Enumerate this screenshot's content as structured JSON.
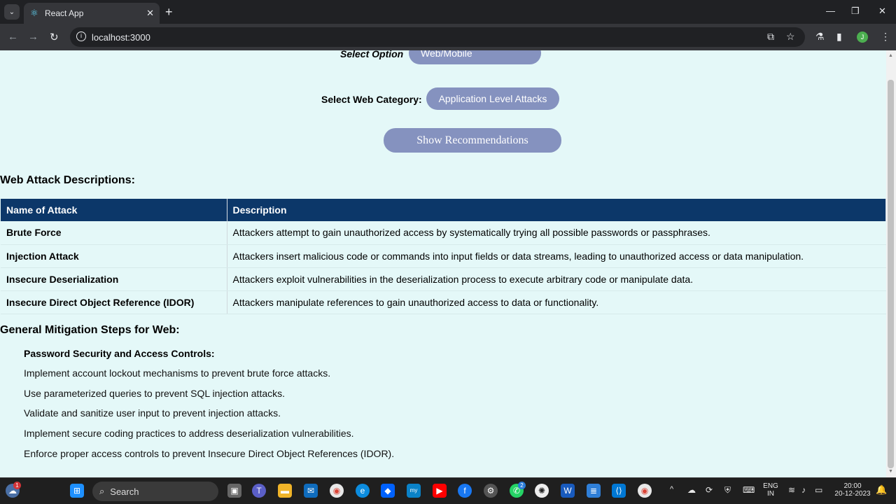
{
  "browser": {
    "tab_title": "React App",
    "url": "localhost:3000",
    "profile_initial": "J",
    "icons": {
      "tab_dropdown": "chevron-down-icon",
      "favicon": "react-icon",
      "close_tab": "close-icon",
      "new_tab": "plus-icon",
      "back": "back-arrow-icon",
      "forward": "forward-arrow-icon",
      "reload": "reload-icon",
      "site_info": "info-icon",
      "install": "install-app-icon",
      "bookmark": "star-icon",
      "labs": "labs-flask-icon",
      "side_panel": "side-panel-icon",
      "menu": "kebab-menu-icon"
    }
  },
  "form": {
    "option_label": "Select Option",
    "option_value": "Web/Mobile",
    "category_label": "Select Web Category:",
    "category_value": "Application Level Attacks",
    "show_button": "Show Recommendations"
  },
  "attacks": {
    "title": "Web Attack Descriptions:",
    "headers": [
      "Name of Attack",
      "Description"
    ],
    "rows": [
      {
        "name": "Brute Force",
        "description": "Attackers attempt to gain unauthorized access by systematically trying all possible passwords or passphrases."
      },
      {
        "name": "Injection Attack",
        "description": "Attackers insert malicious code or commands into input fields or data streams, leading to unauthorized access or data manipulation."
      },
      {
        "name": "Insecure Deserialization",
        "description": "Attackers exploit vulnerabilities in the deserialization process to execute arbitrary code or manipulate data."
      },
      {
        "name": "Insecure Direct Object Reference (IDOR)",
        "description": "Attackers manipulate references to gain unauthorized access to data or functionality."
      }
    ]
  },
  "mitigation": {
    "title": "General Mitigation Steps for Web:",
    "subtitle": "Password Security and Access Controls:",
    "steps": [
      "Implement account lockout mechanisms to prevent brute force attacks.",
      "Use parameterized queries to prevent SQL injection attacks.",
      "Validate and sanitize user input to prevent injection attacks.",
      "Implement secure coding practices to address deserialization vulnerabilities.",
      "Enforce proper access controls to prevent Insecure Direct Object References (IDOR)."
    ]
  },
  "taskbar": {
    "search_placeholder": "Search",
    "weather_badge": "1",
    "whatsapp_badge": "2",
    "language": "ENG",
    "region": "IN",
    "time": "20:00",
    "date": "20-12-2023",
    "apps": [
      "windows-start-icon",
      "task-view-icon",
      "teams-icon",
      "file-explorer-icon",
      "mail-icon",
      "chrome-icon",
      "edge-icon",
      "dropbox-icon",
      "mysql-icon",
      "youtube-icon",
      "facebook-icon",
      "settings-icon",
      "whatsapp-icon",
      "openai-icon",
      "word-icon",
      "notepad-icon",
      "vscode-icon",
      "chrome-active-icon"
    ]
  }
}
